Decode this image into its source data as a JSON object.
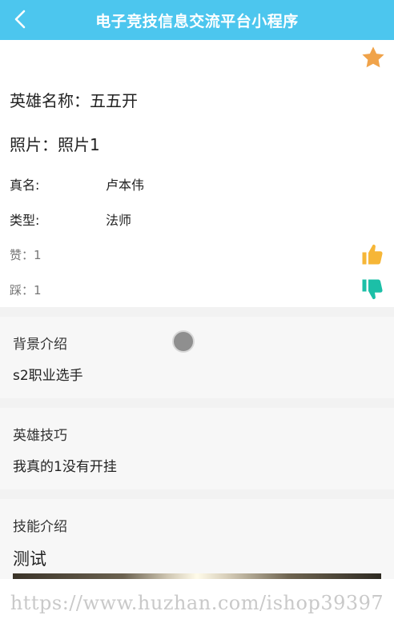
{
  "header": {
    "title": "电子竞技信息交流平台小程序",
    "back_icon": "chevron-left-icon"
  },
  "favorite_icon": "star-icon",
  "hero": {
    "name_label": "英雄名称：",
    "name_value": "五五开",
    "photo_label": "照片：",
    "photo_value": "照片1",
    "realname_label": "真名:",
    "realname_value": "卢本伟",
    "type_label": "类型:",
    "type_value": "法师",
    "like_label": "赞：",
    "like_count": "1",
    "dislike_label": "踩：",
    "dislike_count": "1"
  },
  "sections": {
    "background": {
      "title": "背景介绍",
      "text": "s2职业选手"
    },
    "tips": {
      "title": "英雄技巧",
      "text": "我真的1没有开挂"
    },
    "skills": {
      "title": "技能介绍",
      "text": "测试"
    }
  },
  "watermark": "https://www.huzhan.com/ishop39397",
  "colors": {
    "header": "#4cc6ee",
    "star": "#f0a34a",
    "thumb_up": "#f6b637",
    "thumb_down": "#1cbfa7"
  }
}
